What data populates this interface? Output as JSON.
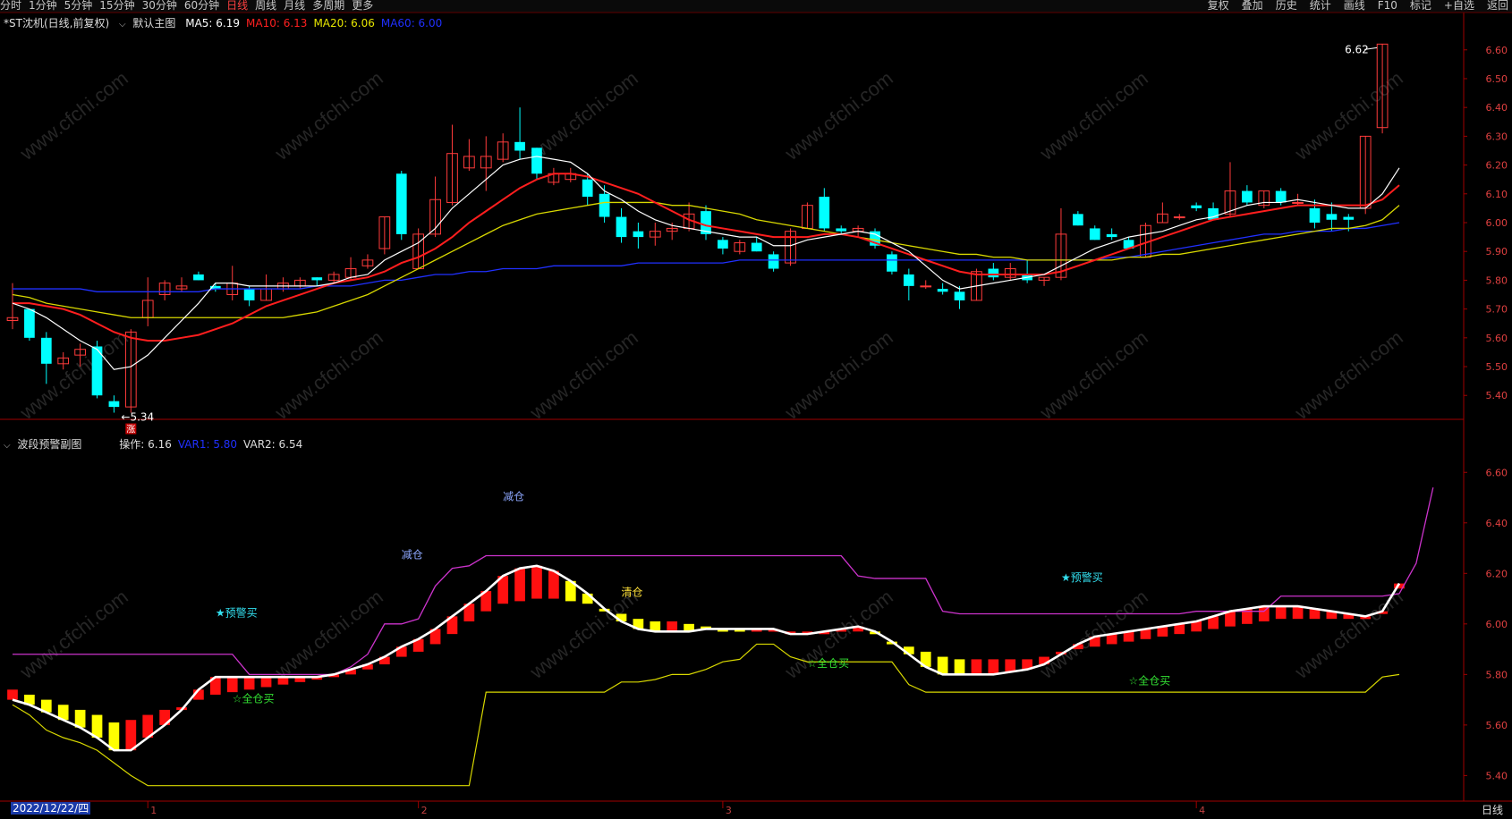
{
  "toolbar": {
    "periods": [
      "分时",
      "1分钟",
      "5分钟",
      "15分钟",
      "30分钟",
      "60分钟",
      "日线",
      "周线",
      "月线",
      "多周期",
      "更多"
    ],
    "active_period": "日线",
    "right": [
      "复权",
      "叠加",
      "历史",
      "统计",
      "画线",
      "F10",
      "标记",
      "+自选",
      "返回"
    ]
  },
  "main": {
    "title": "*ST沈机(日线,前复权)",
    "template": "默认主图",
    "ma": [
      {
        "label": "MA5:",
        "value": "6.19",
        "color": "#ffffff"
      },
      {
        "label": "MA10:",
        "value": "6.13",
        "color": "#ff2020"
      },
      {
        "label": "MA20:",
        "value": "6.06",
        "color": "#e6e600"
      },
      {
        "label": "MA60:",
        "value": "6.00",
        "color": "#2030ff"
      }
    ],
    "high_label": "6.62",
    "low_label": "5.34",
    "low_badge": "涨"
  },
  "sub": {
    "title": "波段预警副图",
    "values": [
      {
        "label": "操作:",
        "value": "6.16",
        "color": "#dddddd"
      },
      {
        "label": "VAR1:",
        "value": "5.80",
        "color": "#2030ff"
      },
      {
        "label": "VAR2:",
        "value": "6.54",
        "color": "#dddddd"
      }
    ]
  },
  "footer": {
    "date": "2022/12/22/四",
    "period": "日线",
    "months": [
      "1",
      "2",
      "3",
      "4"
    ]
  },
  "watermark": "www.cfchi.com",
  "chart_data": {
    "type": "candlestick",
    "ylim": [
      5.32,
      6.68
    ],
    "yticks": [
      "6.60",
      "6.50",
      "6.40",
      "6.30",
      "6.20",
      "6.10",
      "6.00",
      "5.90",
      "5.80",
      "5.70",
      "5.60",
      "5.50",
      "5.40"
    ],
    "candles": [
      {
        "o": 5.66,
        "h": 5.79,
        "l": 5.63,
        "c": 5.67
      },
      {
        "o": 5.7,
        "h": 5.7,
        "l": 5.59,
        "c": 5.6
      },
      {
        "o": 5.6,
        "h": 5.62,
        "l": 5.44,
        "c": 5.51
      },
      {
        "o": 5.51,
        "h": 5.55,
        "l": 5.49,
        "c": 5.53
      },
      {
        "o": 5.54,
        "h": 5.58,
        "l": 5.5,
        "c": 5.56
      },
      {
        "o": 5.57,
        "h": 5.59,
        "l": 5.39,
        "c": 5.4
      },
      {
        "o": 5.38,
        "h": 5.4,
        "l": 5.34,
        "c": 5.36
      },
      {
        "o": 5.36,
        "h": 5.63,
        "l": 5.34,
        "c": 5.62
      },
      {
        "o": 5.67,
        "h": 5.81,
        "l": 5.64,
        "c": 5.73
      },
      {
        "o": 5.75,
        "h": 5.8,
        "l": 5.73,
        "c": 5.79
      },
      {
        "o": 5.77,
        "h": 5.81,
        "l": 5.76,
        "c": 5.78
      },
      {
        "o": 5.82,
        "h": 5.83,
        "l": 5.8,
        "c": 5.8
      },
      {
        "o": 5.78,
        "h": 5.79,
        "l": 5.76,
        "c": 5.77
      },
      {
        "o": 5.75,
        "h": 5.85,
        "l": 5.73,
        "c": 5.79
      },
      {
        "o": 5.77,
        "h": 5.78,
        "l": 5.71,
        "c": 5.73
      },
      {
        "o": 5.73,
        "h": 5.82,
        "l": 5.73,
        "c": 5.77
      },
      {
        "o": 5.77,
        "h": 5.81,
        "l": 5.76,
        "c": 5.79
      },
      {
        "o": 5.78,
        "h": 5.81,
        "l": 5.77,
        "c": 5.8
      },
      {
        "o": 5.81,
        "h": 5.81,
        "l": 5.78,
        "c": 5.8
      },
      {
        "o": 5.8,
        "h": 5.83,
        "l": 5.79,
        "c": 5.82
      },
      {
        "o": 5.81,
        "h": 5.88,
        "l": 5.8,
        "c": 5.84
      },
      {
        "o": 5.85,
        "h": 5.89,
        "l": 5.84,
        "c": 5.87
      },
      {
        "o": 5.91,
        "h": 6.02,
        "l": 5.89,
        "c": 6.02
      },
      {
        "o": 6.17,
        "h": 6.18,
        "l": 5.94,
        "c": 5.96
      },
      {
        "o": 5.84,
        "h": 5.98,
        "l": 5.84,
        "c": 5.96
      },
      {
        "o": 5.96,
        "h": 6.16,
        "l": 5.95,
        "c": 6.08
      },
      {
        "o": 6.07,
        "h": 6.34,
        "l": 6.06,
        "c": 6.24
      },
      {
        "o": 6.19,
        "h": 6.29,
        "l": 6.18,
        "c": 6.23
      },
      {
        "o": 6.19,
        "h": 6.3,
        "l": 6.11,
        "c": 6.23
      },
      {
        "o": 6.22,
        "h": 6.31,
        "l": 6.21,
        "c": 6.28
      },
      {
        "o": 6.28,
        "h": 6.4,
        "l": 6.22,
        "c": 6.25
      },
      {
        "o": 6.26,
        "h": 6.26,
        "l": 6.15,
        "c": 6.17
      },
      {
        "o": 6.14,
        "h": 6.19,
        "l": 6.13,
        "c": 6.17
      },
      {
        "o": 6.15,
        "h": 6.19,
        "l": 6.14,
        "c": 6.17
      },
      {
        "o": 6.15,
        "h": 6.17,
        "l": 6.06,
        "c": 6.09
      },
      {
        "o": 6.1,
        "h": 6.13,
        "l": 6.0,
        "c": 6.02
      },
      {
        "o": 6.02,
        "h": 6.05,
        "l": 5.93,
        "c": 5.95
      },
      {
        "o": 5.97,
        "h": 6.0,
        "l": 5.91,
        "c": 5.95
      },
      {
        "o": 5.95,
        "h": 6.0,
        "l": 5.92,
        "c": 5.97
      },
      {
        "o": 5.97,
        "h": 6.0,
        "l": 5.94,
        "c": 5.98
      },
      {
        "o": 5.98,
        "h": 6.07,
        "l": 5.97,
        "c": 6.03
      },
      {
        "o": 6.04,
        "h": 6.06,
        "l": 5.94,
        "c": 5.96
      },
      {
        "o": 5.94,
        "h": 5.95,
        "l": 5.89,
        "c": 5.91
      },
      {
        "o": 5.9,
        "h": 5.94,
        "l": 5.89,
        "c": 5.93
      },
      {
        "o": 5.93,
        "h": 5.95,
        "l": 5.9,
        "c": 5.9
      },
      {
        "o": 5.89,
        "h": 5.9,
        "l": 5.83,
        "c": 5.84
      },
      {
        "o": 5.86,
        "h": 5.98,
        "l": 5.85,
        "c": 5.97
      },
      {
        "o": 5.98,
        "h": 6.07,
        "l": 5.98,
        "c": 6.06
      },
      {
        "o": 6.09,
        "h": 6.12,
        "l": 5.97,
        "c": 5.98
      },
      {
        "o": 5.98,
        "h": 5.99,
        "l": 5.96,
        "c": 5.97
      },
      {
        "o": 5.97,
        "h": 5.99,
        "l": 5.95,
        "c": 5.98
      },
      {
        "o": 5.97,
        "h": 5.98,
        "l": 5.91,
        "c": 5.92
      },
      {
        "o": 5.89,
        "h": 5.9,
        "l": 5.82,
        "c": 5.83
      },
      {
        "o": 5.82,
        "h": 5.84,
        "l": 5.73,
        "c": 5.78
      },
      {
        "o": 5.78,
        "h": 5.8,
        "l": 5.77,
        "c": 5.78
      },
      {
        "o": 5.77,
        "h": 5.79,
        "l": 5.75,
        "c": 5.76
      },
      {
        "o": 5.76,
        "h": 5.78,
        "l": 5.7,
        "c": 5.73
      },
      {
        "o": 5.73,
        "h": 5.84,
        "l": 5.73,
        "c": 5.83
      },
      {
        "o": 5.84,
        "h": 5.86,
        "l": 5.8,
        "c": 5.81
      },
      {
        "o": 5.81,
        "h": 5.86,
        "l": 5.8,
        "c": 5.84
      },
      {
        "o": 5.82,
        "h": 5.87,
        "l": 5.79,
        "c": 5.8
      },
      {
        "o": 5.8,
        "h": 5.81,
        "l": 5.78,
        "c": 5.81
      },
      {
        "o": 5.81,
        "h": 6.05,
        "l": 5.8,
        "c": 5.96
      },
      {
        "o": 6.03,
        "h": 6.04,
        "l": 5.99,
        "c": 5.99
      },
      {
        "o": 5.98,
        "h": 5.99,
        "l": 5.94,
        "c": 5.94
      },
      {
        "o": 5.96,
        "h": 5.98,
        "l": 5.94,
        "c": 5.95
      },
      {
        "o": 5.94,
        "h": 5.95,
        "l": 5.91,
        "c": 5.91
      },
      {
        "o": 5.88,
        "h": 6.0,
        "l": 5.88,
        "c": 5.99
      },
      {
        "o": 6.0,
        "h": 6.07,
        "l": 6.0,
        "c": 6.03
      },
      {
        "o": 6.02,
        "h": 6.03,
        "l": 6.01,
        "c": 6.02
      },
      {
        "o": 6.06,
        "h": 6.07,
        "l": 6.04,
        "c": 6.05
      },
      {
        "o": 6.05,
        "h": 6.07,
        "l": 6.01,
        "c": 6.01
      },
      {
        "o": 6.03,
        "h": 6.21,
        "l": 6.02,
        "c": 6.11
      },
      {
        "o": 6.11,
        "h": 6.13,
        "l": 6.06,
        "c": 6.07
      },
      {
        "o": 6.06,
        "h": 6.11,
        "l": 6.05,
        "c": 6.11
      },
      {
        "o": 6.11,
        "h": 6.12,
        "l": 6.06,
        "c": 6.07
      },
      {
        "o": 6.07,
        "h": 6.1,
        "l": 6.06,
        "c": 6.07
      },
      {
        "o": 6.05,
        "h": 6.08,
        "l": 5.98,
        "c": 6.0
      },
      {
        "o": 6.03,
        "h": 6.07,
        "l": 5.97,
        "c": 6.01
      },
      {
        "o": 6.02,
        "h": 6.03,
        "l": 5.97,
        "c": 6.01
      },
      {
        "o": 6.05,
        "h": 6.3,
        "l": 6.03,
        "c": 6.3
      },
      {
        "o": 6.33,
        "h": 6.62,
        "l": 6.31,
        "c": 6.62
      }
    ],
    "ma5": [
      5.72,
      5.7,
      5.67,
      5.63,
      5.59,
      5.56,
      5.49,
      5.5,
      5.54,
      5.6,
      5.66,
      5.72,
      5.79,
      5.79,
      5.78,
      5.78,
      5.78,
      5.78,
      5.78,
      5.79,
      5.81,
      5.82,
      5.87,
      5.9,
      5.93,
      5.98,
      6.05,
      6.1,
      6.15,
      6.2,
      6.22,
      6.23,
      6.22,
      6.21,
      6.17,
      6.11,
      6.08,
      6.04,
      6.01,
      5.99,
      5.98,
      5.97,
      5.96,
      5.95,
      5.95,
      5.92,
      5.92,
      5.94,
      5.95,
      5.96,
      5.97,
      5.96,
      5.93,
      5.9,
      5.85,
      5.8,
      5.77,
      5.78,
      5.79,
      5.8,
      5.81,
      5.82,
      5.85,
      5.88,
      5.91,
      5.93,
      5.95,
      5.96,
      5.97,
      5.99,
      6.01,
      6.02,
      6.04,
      6.06,
      6.07,
      6.07,
      6.08,
      6.07,
      6.06,
      6.05,
      6.05,
      6.1,
      6.19
    ],
    "ma10": [
      5.72,
      5.72,
      5.71,
      5.7,
      5.68,
      5.65,
      5.62,
      5.6,
      5.59,
      5.59,
      5.6,
      5.61,
      5.63,
      5.65,
      5.68,
      5.71,
      5.73,
      5.75,
      5.77,
      5.79,
      5.8,
      5.81,
      5.83,
      5.86,
      5.88,
      5.91,
      5.95,
      6.0,
      6.04,
      6.08,
      6.12,
      6.15,
      6.17,
      6.17,
      6.16,
      6.14,
      6.12,
      6.1,
      6.07,
      6.04,
      6.01,
      5.99,
      5.98,
      5.97,
      5.96,
      5.95,
      5.95,
      5.95,
      5.96,
      5.96,
      5.95,
      5.93,
      5.91,
      5.89,
      5.87,
      5.85,
      5.83,
      5.82,
      5.82,
      5.82,
      5.82,
      5.82,
      5.83,
      5.85,
      5.87,
      5.89,
      5.91,
      5.93,
      5.95,
      5.97,
      5.99,
      6.01,
      6.02,
      6.03,
      6.04,
      6.05,
      6.06,
      6.06,
      6.06,
      6.06,
      6.06,
      6.08,
      6.13
    ],
    "ma20": [
      5.75,
      5.74,
      5.72,
      5.71,
      5.7,
      5.69,
      5.68,
      5.67,
      5.67,
      5.67,
      5.67,
      5.67,
      5.67,
      5.67,
      5.67,
      5.67,
      5.67,
      5.68,
      5.69,
      5.71,
      5.73,
      5.75,
      5.78,
      5.81,
      5.84,
      5.87,
      5.9,
      5.93,
      5.96,
      5.99,
      6.01,
      6.03,
      6.04,
      6.05,
      6.06,
      6.07,
      6.07,
      6.07,
      6.07,
      6.06,
      6.06,
      6.05,
      6.04,
      6.03,
      6.01,
      6.0,
      5.99,
      5.98,
      5.97,
      5.96,
      5.95,
      5.94,
      5.93,
      5.92,
      5.91,
      5.9,
      5.89,
      5.89,
      5.88,
      5.88,
      5.87,
      5.87,
      5.87,
      5.87,
      5.87,
      5.87,
      5.88,
      5.88,
      5.89,
      5.89,
      5.9,
      5.91,
      5.92,
      5.93,
      5.94,
      5.95,
      5.96,
      5.97,
      5.98,
      5.98,
      5.99,
      6.01,
      6.06
    ],
    "ma60": [
      5.77,
      5.77,
      5.77,
      5.77,
      5.77,
      5.76,
      5.76,
      5.76,
      5.76,
      5.76,
      5.76,
      5.76,
      5.77,
      5.77,
      5.77,
      5.77,
      5.77,
      5.77,
      5.78,
      5.78,
      5.78,
      5.79,
      5.8,
      5.8,
      5.81,
      5.82,
      5.82,
      5.83,
      5.83,
      5.84,
      5.84,
      5.84,
      5.85,
      5.85,
      5.85,
      5.85,
      5.85,
      5.86,
      5.86,
      5.86,
      5.86,
      5.86,
      5.86,
      5.87,
      5.87,
      5.87,
      5.87,
      5.87,
      5.87,
      5.87,
      5.87,
      5.87,
      5.87,
      5.87,
      5.87,
      5.87,
      5.87,
      5.87,
      5.87,
      5.87,
      5.87,
      5.87,
      5.87,
      5.87,
      5.87,
      5.88,
      5.88,
      5.89,
      5.9,
      5.91,
      5.92,
      5.93,
      5.94,
      5.95,
      5.96,
      5.96,
      5.97,
      5.97,
      5.97,
      5.98,
      5.98,
      5.99,
      6.0
    ],
    "sub_ylim": [
      5.32,
      6.7
    ],
    "sub_yticks": [
      "6.60",
      "6.40",
      "6.20",
      "6.00",
      "5.80",
      "5.60",
      "5.40"
    ],
    "operation": [
      5.74,
      5.72,
      5.7,
      5.68,
      5.66,
      5.64,
      5.61,
      5.62,
      5.64,
      5.66,
      5.67,
      5.7,
      5.72,
      5.73,
      5.74,
      5.75,
      5.76,
      5.77,
      5.78,
      5.79,
      5.8,
      5.82,
      5.84,
      5.87,
      5.89,
      5.92,
      5.96,
      6.01,
      6.05,
      6.08,
      6.09,
      6.1,
      6.1,
      6.09,
      6.08,
      6.06,
      6.04,
      6.02,
      6.01,
      6.01,
      6.0,
      5.99,
      5.98,
      5.97,
      5.97,
      5.97,
      5.97,
      5.97,
      5.97,
      5.97,
      5.97,
      5.96,
      5.93,
      5.91,
      5.89,
      5.87,
      5.86,
      5.86,
      5.86,
      5.86,
      5.86,
      5.87,
      5.89,
      5.9,
      5.91,
      5.92,
      5.93,
      5.94,
      5.95,
      5.96,
      5.97,
      5.98,
      5.99,
      6.0,
      6.01,
      6.02,
      6.02,
      6.02,
      6.02,
      6.02,
      6.02,
      6.04,
      6.14
    ],
    "white_line": [
      5.7,
      5.68,
      5.65,
      5.62,
      5.59,
      5.55,
      5.5,
      5.5,
      5.55,
      5.6,
      5.66,
      5.74,
      5.79,
      5.79,
      5.79,
      5.79,
      5.79,
      5.79,
      5.79,
      5.8,
      5.82,
      5.84,
      5.87,
      5.91,
      5.94,
      5.98,
      6.03,
      6.08,
      6.13,
      6.19,
      6.22,
      6.23,
      6.21,
      6.17,
      6.12,
      6.06,
      6.01,
      5.98,
      5.97,
      5.97,
      5.97,
      5.98,
      5.98,
      5.98,
      5.98,
      5.98,
      5.96,
      5.96,
      5.97,
      5.98,
      5.99,
      5.97,
      5.93,
      5.88,
      5.83,
      5.8,
      5.8,
      5.8,
      5.8,
      5.81,
      5.82,
      5.84,
      5.88,
      5.92,
      5.95,
      5.96,
      5.97,
      5.98,
      5.99,
      6.0,
      6.01,
      6.03,
      6.05,
      6.06,
      6.07,
      6.07,
      6.07,
      6.06,
      6.05,
      6.04,
      6.03,
      6.05,
      6.16
    ],
    "magenta_line": [
      5.88,
      5.88,
      5.88,
      5.88,
      5.88,
      5.88,
      5.88,
      5.88,
      5.88,
      5.88,
      5.88,
      5.88,
      5.88,
      5.88,
      5.8,
      5.8,
      5.8,
      5.8,
      5.8,
      5.8,
      5.83,
      5.88,
      6.0,
      6.0,
      6.02,
      6.15,
      6.22,
      6.23,
      6.27,
      6.27,
      6.27,
      6.27,
      6.27,
      6.27,
      6.27,
      6.27,
      6.27,
      6.27,
      6.27,
      6.27,
      6.27,
      6.27,
      6.27,
      6.27,
      6.27,
      6.27,
      6.27,
      6.27,
      6.27,
      6.27,
      6.19,
      6.18,
      6.18,
      6.18,
      6.18,
      6.05,
      6.04,
      6.04,
      6.04,
      6.04,
      6.04,
      6.04,
      6.04,
      6.04,
      6.04,
      6.04,
      6.04,
      6.04,
      6.04,
      6.04,
      6.05,
      6.05,
      6.05,
      6.05,
      6.05,
      6.11,
      6.11,
      6.11,
      6.11,
      6.11,
      6.11,
      6.11,
      6.12,
      6.24,
      6.54
    ],
    "yellow_line": [
      5.68,
      5.64,
      5.58,
      5.55,
      5.53,
      5.5,
      5.45,
      5.4,
      5.36,
      5.36,
      5.36,
      5.36,
      5.36,
      5.36,
      5.36,
      5.36,
      5.36,
      5.36,
      5.36,
      5.36,
      5.36,
      5.36,
      5.36,
      5.36,
      5.36,
      5.36,
      5.36,
      5.36,
      5.73,
      5.73,
      5.73,
      5.73,
      5.73,
      5.73,
      5.73,
      5.73,
      5.77,
      5.77,
      5.78,
      5.8,
      5.8,
      5.82,
      5.85,
      5.86,
      5.92,
      5.92,
      5.87,
      5.85,
      5.85,
      5.85,
      5.85,
      5.85,
      5.85,
      5.76,
      5.73,
      5.73,
      5.73,
      5.73,
      5.73,
      5.73,
      5.73,
      5.73,
      5.73,
      5.73,
      5.73,
      5.73,
      5.73,
      5.73,
      5.73,
      5.73,
      5.73,
      5.73,
      5.73,
      5.73,
      5.73,
      5.73,
      5.73,
      5.73,
      5.73,
      5.73,
      5.73,
      5.79,
      5.8
    ],
    "annotations": [
      {
        "text": "减仓",
        "color": "#8ea8ff",
        "i": 29,
        "v": 6.49
      },
      {
        "text": "减仓",
        "color": "#8ea8ff",
        "i": 23,
        "v": 6.26
      },
      {
        "text": "★预警买",
        "color": "#33e0f0",
        "i": 12,
        "v": 6.03
      },
      {
        "text": "清仓",
        "color": "#ffe13a",
        "i": 36,
        "v": 6.11
      },
      {
        "text": "☆全仓买",
        "color": "#33e033",
        "i": 13,
        "v": 5.69
      },
      {
        "text": "☆全仓买",
        "color": "#33e033",
        "i": 47,
        "v": 5.83
      },
      {
        "text": "★预警买",
        "color": "#33e0f0",
        "i": 62,
        "v": 6.17
      },
      {
        "text": "☆全仓买",
        "color": "#33e033",
        "i": 66,
        "v": 5.76
      }
    ]
  }
}
